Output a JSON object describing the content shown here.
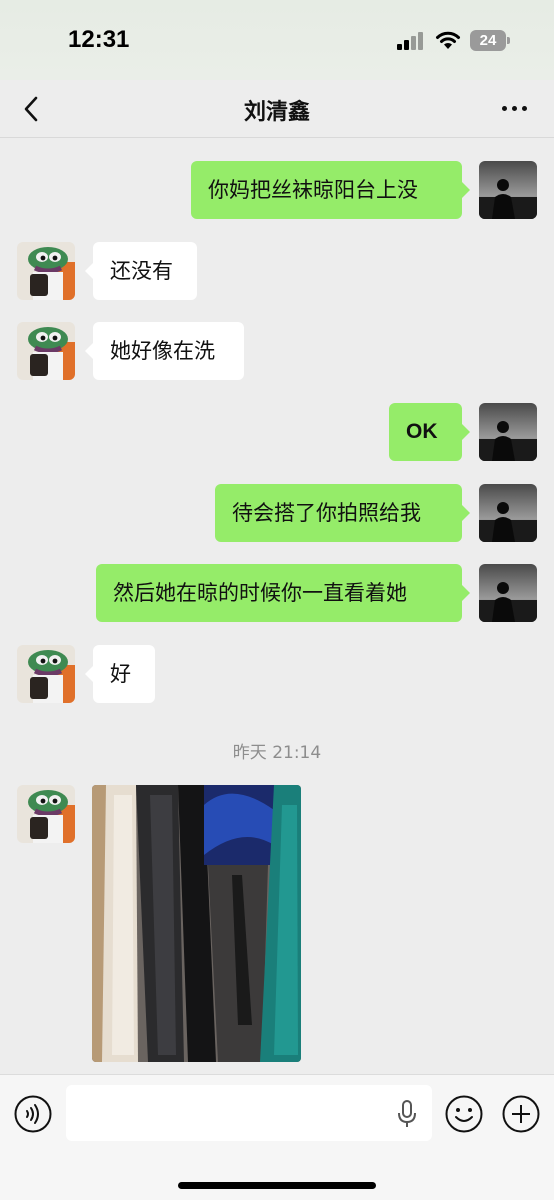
{
  "status_bar": {
    "time": "12:31",
    "battery": "24"
  },
  "navbar": {
    "title": "刘清鑫"
  },
  "messages": [
    {
      "side": "out",
      "text": "你妈把丝袜晾阳台上没"
    },
    {
      "side": "in",
      "text": "还没有"
    },
    {
      "side": "in",
      "text": "她好像在洗"
    },
    {
      "side": "out",
      "text": "OK"
    },
    {
      "side": "out",
      "text": "待会搭了你拍照给我"
    },
    {
      "side": "out",
      "text": "然后她在晾的时候你一直看着她"
    },
    {
      "side": "in",
      "text": "好"
    }
  ],
  "timestamp": "昨天 21:14",
  "photo_message": {
    "side": "in",
    "content": "photo of hanging stockings and clothes"
  },
  "input_bar": {
    "value": "",
    "placeholder": ""
  },
  "colors": {
    "outgoing_bubble": "#95ec69",
    "incoming_bubble": "#ffffff",
    "background": "#ededed"
  },
  "icons": [
    "back-icon",
    "more-icon",
    "voice-icon",
    "mic-icon",
    "emoji-icon",
    "plus-icon"
  ]
}
